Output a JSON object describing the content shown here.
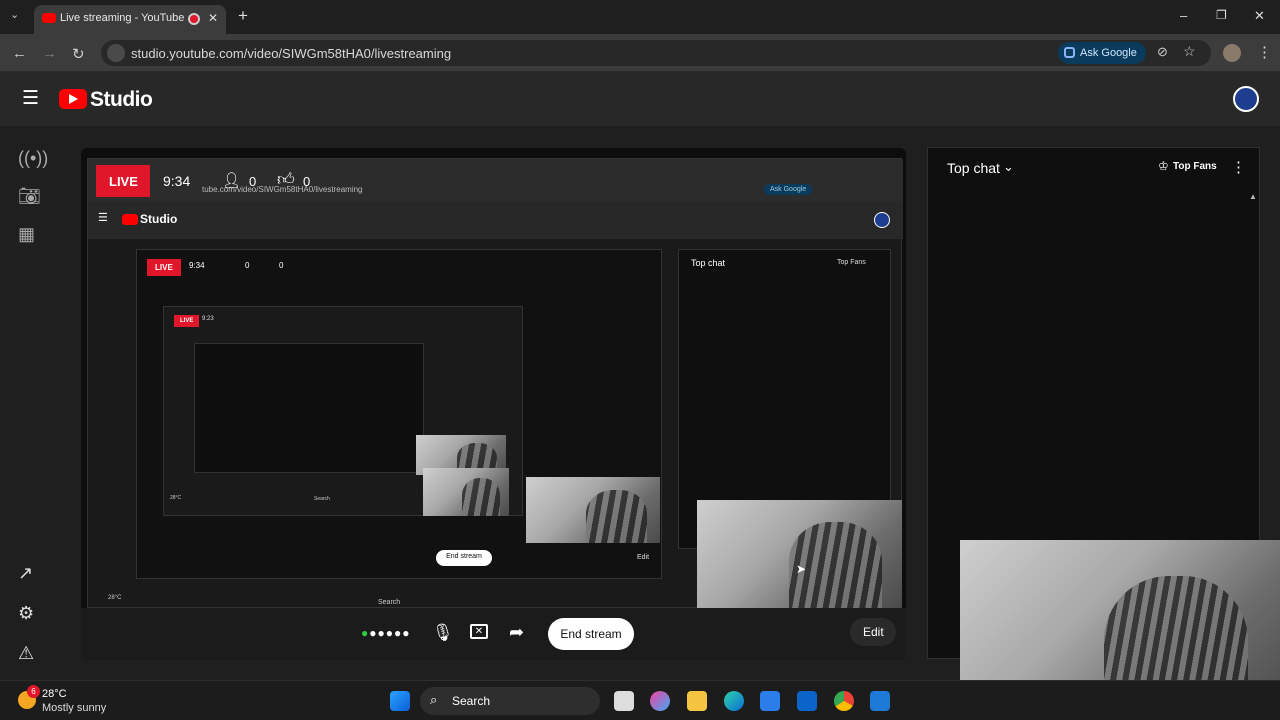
{
  "browser": {
    "tab_title": "Live streaming - YouTube Studio",
    "new_tab": "+",
    "url": "studio.youtube.com/video/SIWGm58tHA0/livestreaming",
    "ask_google": "Ask Google",
    "win_min": "–",
    "win_max": "❐",
    "win_close": "✕"
  },
  "studio": {
    "logo_text": "Studio"
  },
  "stream": {
    "live_label": "LIVE",
    "elapsed": "9:34",
    "viewers": "0",
    "likes": "0",
    "end_stream": "End stream",
    "edit": "Edit"
  },
  "chat": {
    "title": "Top chat",
    "top_fans": "Top Fans"
  },
  "nested": {
    "url": "tube.com/video/SIWGm58tHA0/livestreaming",
    "ask_google": "Ask Google",
    "studio": "Studio",
    "live": "LIVE",
    "elapsed": "9:34",
    "viewers": "0",
    "likes": "0",
    "top_chat": "Top chat",
    "top_fans": "Top Fans",
    "end_stream": "End stream",
    "edit": "Edit",
    "weather": "28°C",
    "search": "Search",
    "elapsed_2": "9:23",
    "weather_2": "28°C",
    "search_2": "Search",
    "live_3": "LIVE"
  },
  "taskbar": {
    "temp": "28°C",
    "weather": "Mostly sunny",
    "badge": "6",
    "search": "Search"
  },
  "colors": {
    "live_red": "#e0162b",
    "youtube_red": "#ff0000",
    "accent_blue": "#0b3b5c"
  }
}
